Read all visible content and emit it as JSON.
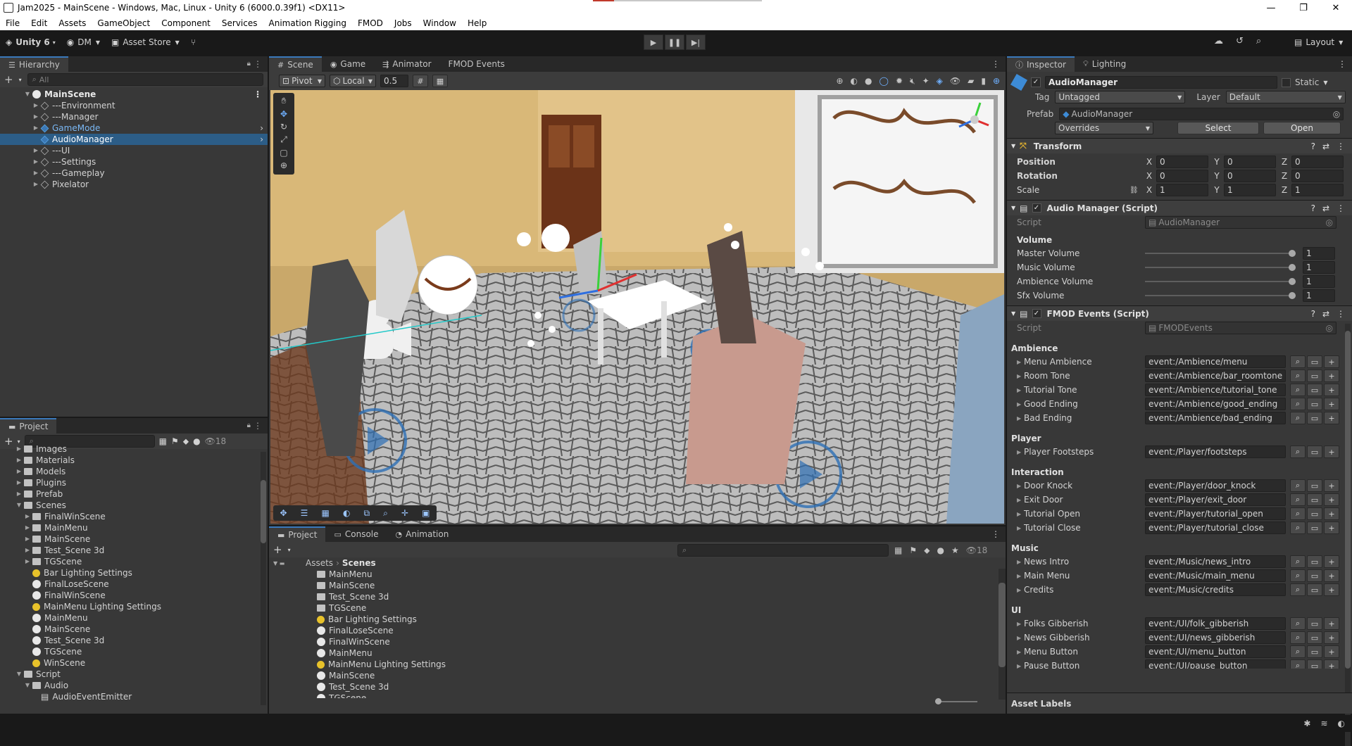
{
  "window": {
    "title": "Jam2025 - MainScene - Windows, Mac, Linux - Unity 6 (6000.0.39f1) <DX11>",
    "min": "—",
    "max": "❐",
    "close": "✕"
  },
  "menu": [
    "File",
    "Edit",
    "Assets",
    "GameObject",
    "Component",
    "Services",
    "Animation Rigging",
    "FMOD",
    "Jobs",
    "Window",
    "Help"
  ],
  "toolbar": {
    "unity": "Unity 6",
    "account": "DM",
    "store": "Asset Store",
    "layout": "Layout"
  },
  "hierarchy": {
    "tab": "Hierarchy",
    "search": "All",
    "scene": "MainScene",
    "items": [
      "---Environment",
      "---Manager",
      "GameMode",
      "AudioManager",
      "---UI",
      "---Settings",
      "---Gameplay",
      "Pixelator"
    ]
  },
  "project_left": {
    "tab": "Project",
    "count": "18",
    "items": [
      {
        "label": "Images",
        "kind": "folder",
        "indent": 1
      },
      {
        "label": "Materials",
        "kind": "folder",
        "indent": 1
      },
      {
        "label": "Models",
        "kind": "folder",
        "indent": 1
      },
      {
        "label": "Plugins",
        "kind": "folder",
        "indent": 1
      },
      {
        "label": "Prefab",
        "kind": "folder",
        "indent": 1
      },
      {
        "label": "Scenes",
        "kind": "folder",
        "indent": 1,
        "open": true
      },
      {
        "label": "FinalWinScene",
        "kind": "folder",
        "indent": 2
      },
      {
        "label": "MainMenu",
        "kind": "folder",
        "indent": 2
      },
      {
        "label": "MainScene",
        "kind": "folder",
        "indent": 2
      },
      {
        "label": "Test_Scene 3d",
        "kind": "folder",
        "indent": 2
      },
      {
        "label": "TGScene",
        "kind": "folder",
        "indent": 2
      },
      {
        "label": "Bar Lighting Settings",
        "kind": "light",
        "indent": 2
      },
      {
        "label": "FinalLoseScene",
        "kind": "unity",
        "indent": 2
      },
      {
        "label": "FinalWinScene",
        "kind": "unity",
        "indent": 2
      },
      {
        "label": "MainMenu Lighting Settings",
        "kind": "light",
        "indent": 2
      },
      {
        "label": "MainMenu",
        "kind": "unity",
        "indent": 2
      },
      {
        "label": "MainScene",
        "kind": "unity",
        "indent": 2
      },
      {
        "label": "Test_Scene 3d",
        "kind": "unity",
        "indent": 2
      },
      {
        "label": "TGScene",
        "kind": "unity",
        "indent": 2
      },
      {
        "label": "WinScene",
        "kind": "light",
        "indent": 2
      },
      {
        "label": "Script",
        "kind": "folder",
        "indent": 1,
        "open": true
      },
      {
        "label": "Audio",
        "kind": "folder",
        "indent": 2,
        "open": true
      },
      {
        "label": "AudioEventEmitter",
        "kind": "script",
        "indent": 3
      }
    ]
  },
  "scene_tabs": [
    "Scene",
    "Game",
    "Animator",
    "FMOD Events"
  ],
  "scene_toolbar": {
    "pivot": "Pivot",
    "local": "Local",
    "snap": "0.5"
  },
  "bottom": {
    "tabs": [
      "Project",
      "Console",
      "Animation"
    ],
    "count": "18",
    "breadcrumb_root": "Assets",
    "breadcrumb_current": "Scenes",
    "items": [
      {
        "label": "MainMenu",
        "kind": "folder"
      },
      {
        "label": "MainScene",
        "kind": "folder"
      },
      {
        "label": "Test_Scene 3d",
        "kind": "folder"
      },
      {
        "label": "TGScene",
        "kind": "folder"
      },
      {
        "label": "Bar Lighting Settings",
        "kind": "light"
      },
      {
        "label": "FinalLoseScene",
        "kind": "unity"
      },
      {
        "label": "FinalWinScene",
        "kind": "unity"
      },
      {
        "label": "MainMenu",
        "kind": "unity"
      },
      {
        "label": "MainMenu Lighting Settings",
        "kind": "light"
      },
      {
        "label": "MainScene",
        "kind": "unity"
      },
      {
        "label": "Test_Scene 3d",
        "kind": "unity"
      },
      {
        "label": "TGScene",
        "kind": "unity"
      }
    ]
  },
  "inspector": {
    "tabs": [
      "Inspector",
      "Lighting"
    ],
    "name": "AudioManager",
    "static": "Static",
    "tag_label": "Tag",
    "tag": "Untagged",
    "layer_label": "Layer",
    "layer": "Default",
    "prefab_label": "Prefab",
    "prefab": "AudioManager",
    "overrides": "Overrides",
    "select": "Select",
    "open": "Open",
    "transform": {
      "title": "Transform",
      "position": "Position",
      "rotation": "Rotation",
      "scale": "Scale",
      "pos": [
        "0",
        "0",
        "0"
      ],
      "rot": [
        "0",
        "0",
        "0"
      ],
      "scl": [
        "1",
        "1",
        "1"
      ],
      "axes": [
        "X",
        "Y",
        "Z"
      ]
    },
    "audio": {
      "title": "Audio Manager (Script)",
      "script_label": "Script",
      "script": "AudioManager",
      "section": "Volume",
      "volumes": [
        {
          "label": "Master Volume",
          "value": "1"
        },
        {
          "label": "Music Volume",
          "value": "1"
        },
        {
          "label": "Ambience Volume",
          "value": "1"
        },
        {
          "label": "Sfx Volume",
          "value": "1"
        }
      ]
    },
    "fmod": {
      "title": "FMOD Events (Script)",
      "script_label": "Script",
      "script": "FMODEvents",
      "groups": [
        {
          "name": "Ambience",
          "events": [
            {
              "label": "Menu Ambience",
              "path": "event:/Ambience/menu"
            },
            {
              "label": "Room Tone",
              "path": "event:/Ambience/bar_roomtone"
            },
            {
              "label": "Tutorial Tone",
              "path": "event:/Ambience/tutorial_tone"
            },
            {
              "label": "Good Ending",
              "path": "event:/Ambience/good_ending"
            },
            {
              "label": "Bad Ending",
              "path": "event:/Ambience/bad_ending"
            }
          ]
        },
        {
          "name": "Player",
          "events": [
            {
              "label": "Player Footsteps",
              "path": "event:/Player/footsteps"
            }
          ]
        },
        {
          "name": "Interaction",
          "events": [
            {
              "label": "Door Knock",
              "path": "event:/Player/door_knock"
            },
            {
              "label": "Exit Door",
              "path": "event:/Player/exit_door"
            },
            {
              "label": "Tutorial Open",
              "path": "event:/Player/tutorial_open"
            },
            {
              "label": "Tutorial Close",
              "path": "event:/Player/tutorial_close"
            }
          ]
        },
        {
          "name": "Music",
          "events": [
            {
              "label": "News Intro",
              "path": "event:/Music/news_intro"
            },
            {
              "label": "Main Menu",
              "path": "event:/Music/main_menu"
            },
            {
              "label": "Credits",
              "path": "event:/Music/credits"
            }
          ]
        },
        {
          "name": "UI",
          "events": [
            {
              "label": "Folks Gibberish",
              "path": "event:/UI/folk_gibberish"
            },
            {
              "label": "News Gibberish",
              "path": "event:/UI/news_gibberish"
            },
            {
              "label": "Menu Button",
              "path": "event:/UI/menu_button"
            },
            {
              "label": "Pause Button",
              "path": "event:/UI/pause_button"
            }
          ]
        }
      ]
    },
    "asset_labels": "Asset Labels"
  },
  "colors": {
    "accent": "#3a79bb",
    "selection": "#2c5d87",
    "panel": "#383838",
    "dark": "#191919"
  }
}
